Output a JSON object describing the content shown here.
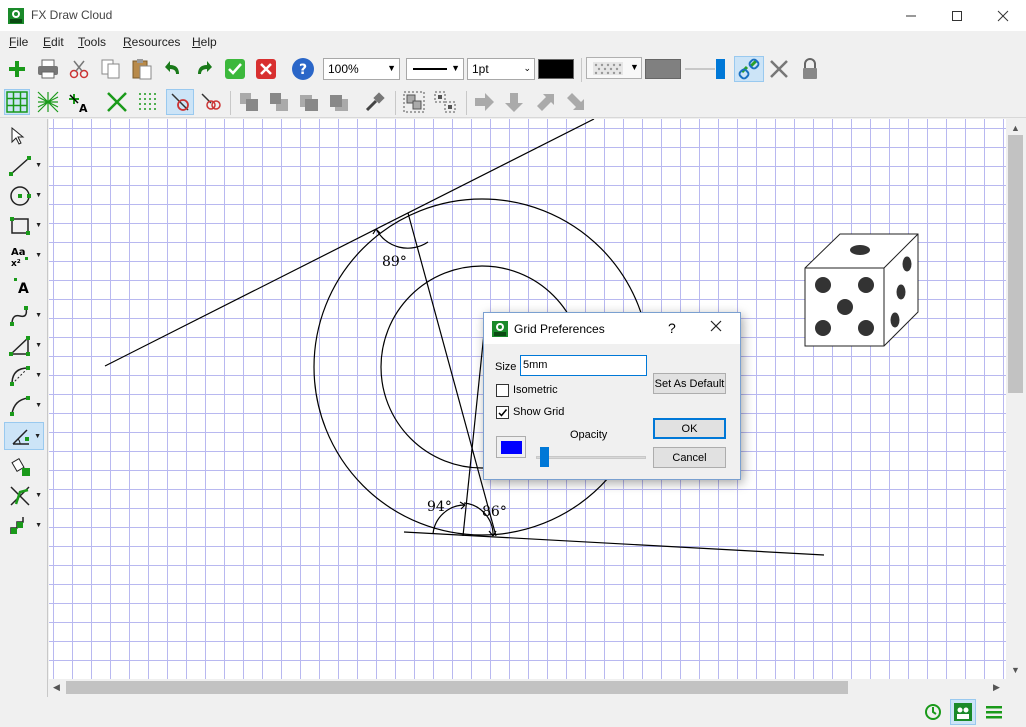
{
  "window": {
    "title": "FX Draw Cloud"
  },
  "menu": [
    {
      "first": "F",
      "rest": "ile"
    },
    {
      "first": "E",
      "rest": "dit"
    },
    {
      "first": "T",
      "rest": "ools"
    },
    {
      "first": "R",
      "rest": "esources"
    },
    {
      "first": "H",
      "rest": "elp"
    }
  ],
  "toolbar": {
    "zoom": "100%",
    "line_width": "1pt",
    "line_color": "#000000",
    "fill_color": "#808080",
    "accent": "#0078d7"
  },
  "drawing": {
    "angle1": "89°",
    "angle2": "94°",
    "angle3": "86°"
  },
  "dialog": {
    "title": "Grid Preferences",
    "help": "?",
    "size_label": "Size",
    "size_value": "5mm",
    "isometric_label": "Isometric",
    "isometric_checked": false,
    "show_grid_label": "Show Grid",
    "show_grid_checked": true,
    "opacity_label": "Opacity",
    "opacity_level": 0.05,
    "grid_color": "#0000ff",
    "set_default_label": "Set As Default",
    "ok_label": "OK",
    "cancel_label": "Cancel"
  }
}
